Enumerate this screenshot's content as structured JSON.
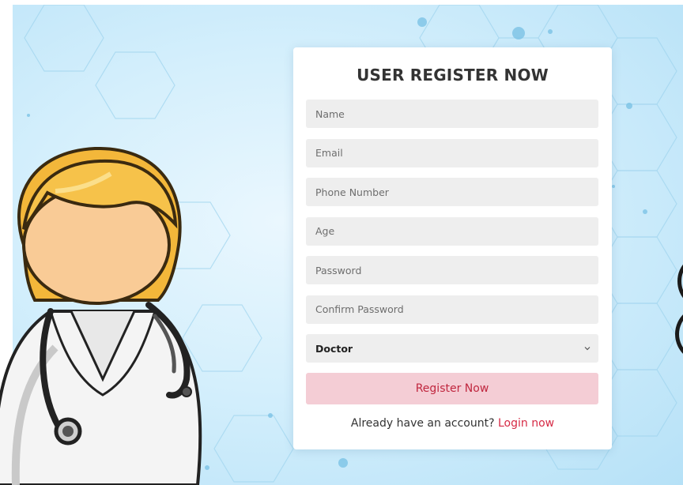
{
  "form": {
    "title": "USER REGISTER NOW",
    "fields": {
      "name": {
        "placeholder": "Name",
        "value": ""
      },
      "email": {
        "placeholder": "Email",
        "value": ""
      },
      "phone": {
        "placeholder": "Phone Number",
        "value": ""
      },
      "age": {
        "placeholder": "Age",
        "value": ""
      },
      "password": {
        "placeholder": "Password",
        "value": ""
      },
      "confirm_password": {
        "placeholder": "Confirm Password",
        "value": ""
      }
    },
    "role_select": {
      "selected": "Doctor"
    },
    "submit_label": "Register Now",
    "login_prompt": "Already have an account?",
    "login_link": "Login now"
  },
  "illustration": {
    "name": "doctor-illustration"
  },
  "icons": {
    "select_chevron": "chevron-down-icon"
  },
  "colors": {
    "background": "#d4effc",
    "card": "#ffffff",
    "input_bg": "#eeeeee",
    "submit_bg": "#f4cdd5",
    "accent": "#d62a45"
  }
}
